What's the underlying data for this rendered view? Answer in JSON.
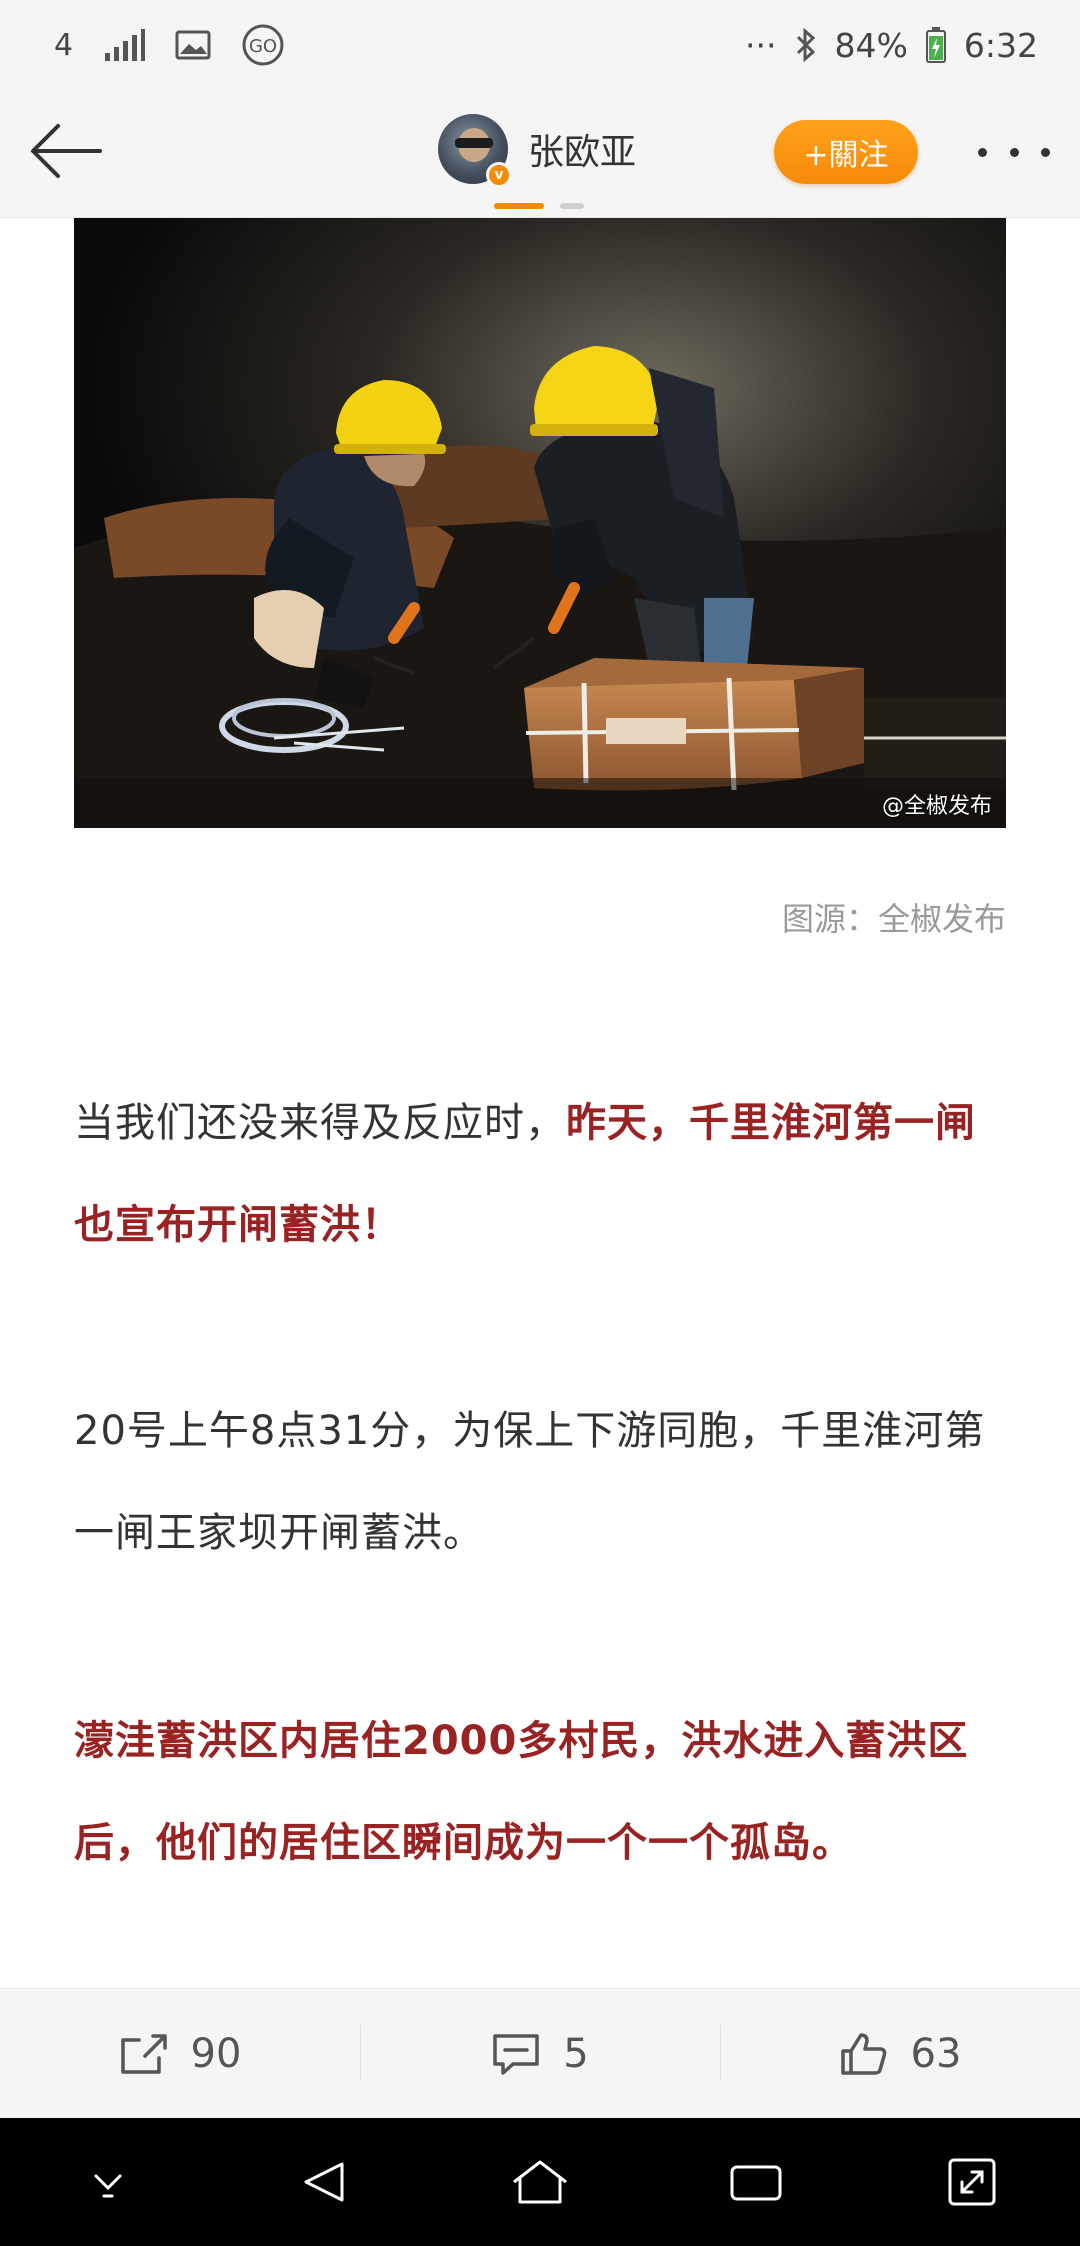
{
  "status_bar": {
    "network": "4G",
    "battery": "84%",
    "time": "6:32",
    "icons": [
      "network-4g-icon",
      "signal-icon",
      "image-icon",
      "go-icon",
      "more-dots-icon",
      "bluetooth-icon",
      "battery-charging-icon"
    ]
  },
  "header": {
    "author_name": "张欧亚",
    "follow_label": "+關注",
    "verified": true,
    "accent_color": "#f58a07"
  },
  "article": {
    "photo_watermark": "@全椒发布",
    "image_source": "图源：全椒发布",
    "paragraphs": [
      {
        "normal": "当我们还没来得及反应时，",
        "highlight": "昨天，千里淮河第一闸也宣布开闸蓄洪！"
      },
      {
        "normal": "20号上午8点31分，为保上下游同胞，千里淮河第一闸王家坝开闸蓄洪。"
      },
      {
        "highlight": "濛洼蓄洪区内居住2000多村民，洪水进入蓄洪区后，他们的居住区瞬间成为一个一个孤岛。"
      }
    ],
    "highlight_color": "#992222"
  },
  "actions": {
    "share_count": "90",
    "comment_count": "5",
    "like_count": "63"
  }
}
